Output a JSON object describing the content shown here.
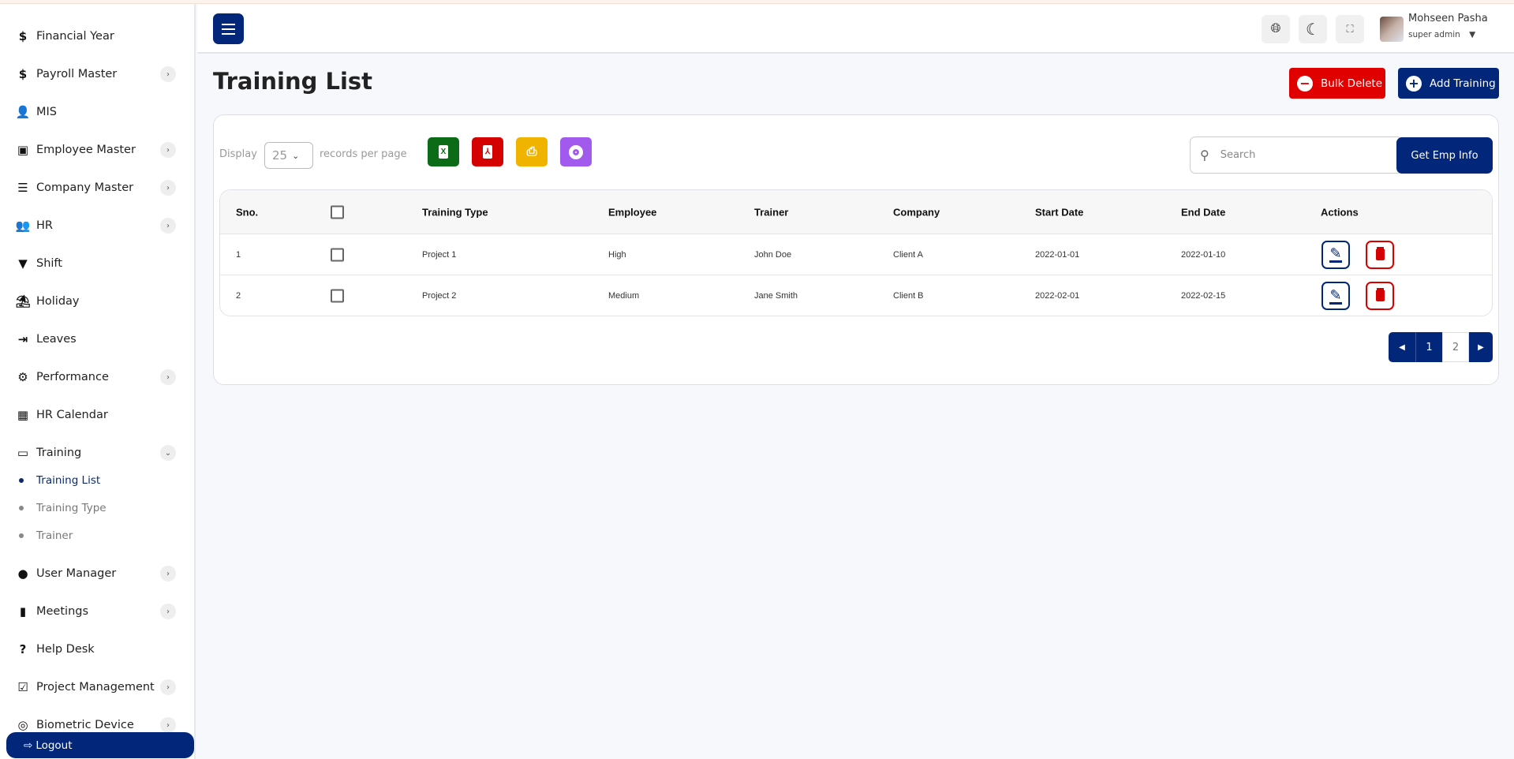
{
  "sidebar": {
    "items": [
      {
        "label": "Financial Year",
        "icon": "dollar-icon",
        "glyph": "$",
        "chevron": false
      },
      {
        "label": "Payroll Master",
        "icon": "dollar-icon",
        "glyph": "$",
        "chevron": true
      },
      {
        "label": "MIS",
        "icon": "user-gear-icon",
        "glyph": "👤",
        "chevron": false
      },
      {
        "label": "Employee Master",
        "icon": "id-badge-icon",
        "glyph": "▣",
        "chevron": true
      },
      {
        "label": "Company Master",
        "icon": "server-icon",
        "glyph": "☰",
        "chevron": true
      },
      {
        "label": "HR",
        "icon": "users-icon",
        "glyph": "👥",
        "chevron": true
      },
      {
        "label": "Shift",
        "icon": "filter-icon",
        "glyph": "▼",
        "chevron": false
      },
      {
        "label": "Holiday",
        "icon": "umbrella-beach-icon",
        "glyph": "⛱",
        "chevron": false
      },
      {
        "label": "Leaves",
        "icon": "sign-out-icon",
        "glyph": "⇥",
        "chevron": false
      },
      {
        "label": "Performance",
        "icon": "gears-icon",
        "glyph": "⚙",
        "chevron": true
      },
      {
        "label": "HR Calendar",
        "icon": "calendar-icon",
        "glyph": "▦",
        "chevron": false
      },
      {
        "label": "Training",
        "icon": "chalkboard-teacher-icon",
        "glyph": "▭",
        "chevron": true
      }
    ],
    "sub_items": [
      {
        "label": "Training List",
        "active": true
      },
      {
        "label": "Training Type",
        "active": false
      },
      {
        "label": "Trainer",
        "active": false
      }
    ],
    "items_after": [
      {
        "label": "User Manager",
        "icon": "user-icon",
        "glyph": "●",
        "chevron": true
      },
      {
        "label": "Meetings",
        "icon": "door-icon",
        "glyph": "▮",
        "chevron": true
      },
      {
        "label": "Help Desk",
        "icon": "question-circle-icon",
        "glyph": "?",
        "chevron": false
      },
      {
        "label": "Project Management",
        "icon": "check-square-icon",
        "glyph": "☑",
        "chevron": true
      },
      {
        "label": "Biometric Device",
        "icon": "fingerprint-icon",
        "glyph": "◎",
        "chevron": true
      }
    ],
    "logout": "Logout"
  },
  "header": {
    "user_name": "Mohseen Pasha",
    "user_role": "super admin"
  },
  "page": {
    "title": "Training List",
    "bulk_delete": "Bulk Delete",
    "add_training": "Add Training"
  },
  "toolbar": {
    "display": "Display",
    "per_page": "25",
    "records_per_page": "records per page",
    "search_placeholder": "Search",
    "get_emp_info": "Get Emp Info"
  },
  "table": {
    "columns": [
      "Sno.",
      "",
      "Training Type",
      "Employee",
      "Trainer",
      "Company",
      "Start Date",
      "End Date",
      "Actions"
    ],
    "rows": [
      {
        "sno": "1",
        "training_type": "Project 1",
        "employee": "High",
        "trainer": "John Doe",
        "company": "Client A",
        "start_date": "2022-01-01",
        "end_date": "2022-01-10"
      },
      {
        "sno": "2",
        "training_type": "Project 2",
        "employee": "Medium",
        "trainer": "Jane Smith",
        "company": "Client B",
        "start_date": "2022-02-01",
        "end_date": "2022-02-15"
      }
    ]
  },
  "pagination": {
    "pages": [
      "1",
      "2"
    ],
    "current": "1"
  },
  "colors": {
    "primary": "#022679",
    "danger": "#e00000",
    "excel": "#0b6b16",
    "pdf": "#d50000",
    "print": "#f0b400",
    "view": "#a259ee"
  }
}
